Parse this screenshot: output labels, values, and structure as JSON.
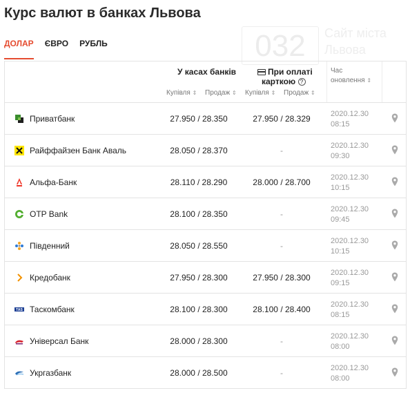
{
  "page": {
    "title": "Курс валют в банках Львова"
  },
  "watermark": {
    "number": "032",
    "line1": "Сайт міста",
    "line2": "Львова"
  },
  "tabs": [
    {
      "label": "ДОЛАР",
      "active": true
    },
    {
      "label": "ЄВРО",
      "active": false
    },
    {
      "label": "РУБЛЬ",
      "active": false
    }
  ],
  "header": {
    "cash_title": "У касах банків",
    "card_title_1": "При оплаті",
    "card_title_2": "карткою",
    "time_title_1": "Час",
    "time_title_2": "оновлення",
    "buy": "Купівля",
    "sell": "Продаж",
    "sort_glyph": "⇕",
    "help_glyph": "?",
    "separator": "/"
  },
  "colors": {
    "accent": "#e54b2f",
    "pin": "#aaaaaa"
  },
  "rows": [
    {
      "bank": "Приватбанк",
      "logo": "privatbank-logo",
      "cash": "27.950 / 28.350",
      "card": "27.950 / 28.329",
      "date": "2020.12.30",
      "time": "08:15"
    },
    {
      "bank": "Райффайзен Банк Аваль",
      "logo": "raiffeisen-logo",
      "cash": "28.050 / 28.370",
      "card": "-",
      "date": "2020.12.30",
      "time": "09:30"
    },
    {
      "bank": "Альфа-Банк",
      "logo": "alfabank-logo",
      "cash": "28.110 / 28.290",
      "card": "28.000 / 28.700",
      "date": "2020.12.30",
      "time": "10:15"
    },
    {
      "bank": "OTP Bank",
      "logo": "otpbank-logo",
      "cash": "28.100 / 28.350",
      "card": "-",
      "date": "2020.12.30",
      "time": "09:45"
    },
    {
      "bank": "Південний",
      "logo": "pivdennyi-logo",
      "cash": "28.050 / 28.550",
      "card": "-",
      "date": "2020.12.30",
      "time": "10:15"
    },
    {
      "bank": "Кредобанк",
      "logo": "kredobank-logo",
      "cash": "27.950 / 28.300",
      "card": "27.950 / 28.300",
      "date": "2020.12.30",
      "time": "09:15"
    },
    {
      "bank": "Таскомбанк",
      "logo": "taskombank-logo",
      "cash": "28.100 / 28.300",
      "card": "28.100 / 28.400",
      "date": "2020.12.30",
      "time": "08:15"
    },
    {
      "bank": "Універсал Банк",
      "logo": "universal-bank-logo",
      "cash": "28.000 / 28.300",
      "card": "-",
      "date": "2020.12.30",
      "time": "08:00"
    },
    {
      "bank": "Укргазбанк",
      "logo": "ukrgasbank-logo",
      "cash": "28.000 / 28.500",
      "card": "-",
      "date": "2020.12.30",
      "time": "08:00"
    }
  ]
}
